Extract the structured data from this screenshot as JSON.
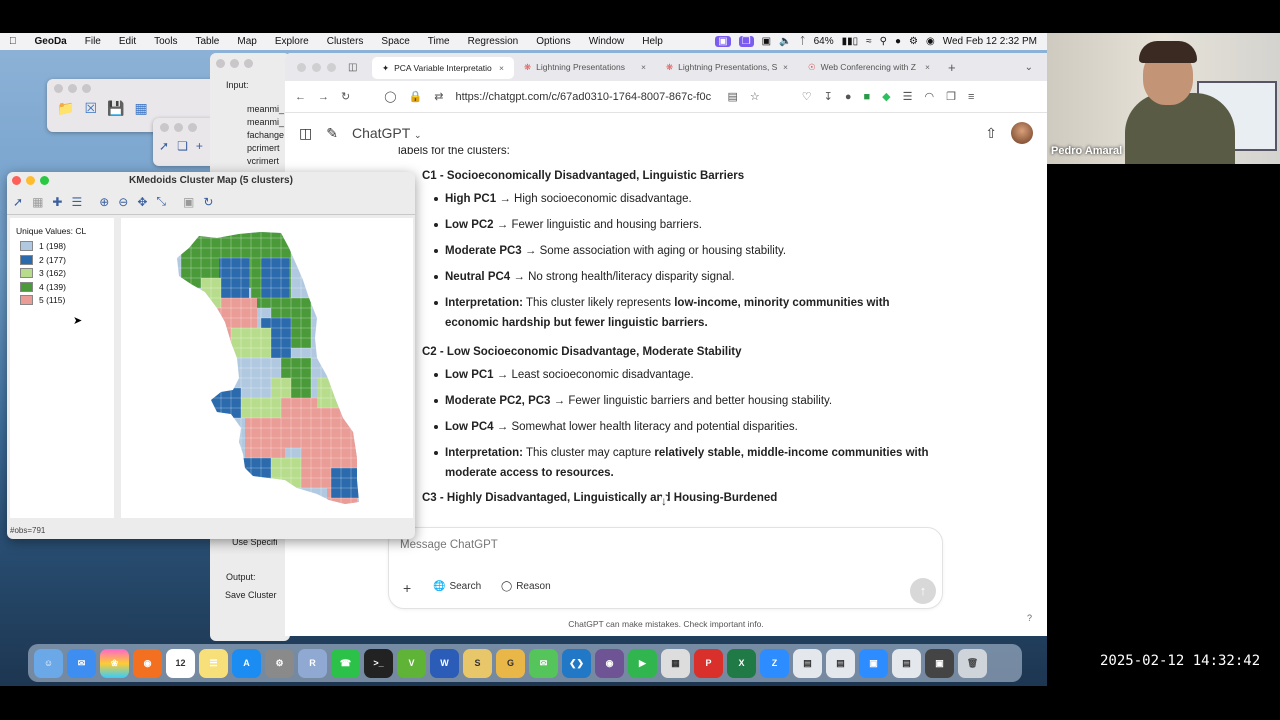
{
  "menubar": {
    "app": "GeoDa",
    "items": [
      "File",
      "Edit",
      "Tools",
      "Table",
      "Map",
      "Explore",
      "Clusters",
      "Space",
      "Time",
      "Regression",
      "Options",
      "Window",
      "Help"
    ],
    "battery": "64%",
    "datetime": "Wed Feb 12  2:32 PM"
  },
  "dialog": {
    "input_label": "Input:",
    "vars": [
      "meanmi_",
      "meanmi_",
      "fachange",
      "pcrimert",
      "vcrimert"
    ],
    "use_specific": "Use Specifi",
    "output_label": "Output:",
    "save_cluster": "Save Cluster"
  },
  "cluster_map": {
    "title": "KMedoids Cluster Map (5 clusters)",
    "legend_title": "Unique Values: CL",
    "legend": [
      {
        "label": "1 (198)",
        "color": "#b1c9e0"
      },
      {
        "label": "2 (177)",
        "color": "#2b6aad"
      },
      {
        "label": "3 (162)",
        "color": "#b7dd8c"
      },
      {
        "label": "4 (139)",
        "color": "#4a9a3a"
      },
      {
        "label": "5 (115)",
        "color": "#ea9c97"
      }
    ],
    "status": "#obs=791"
  },
  "browser": {
    "tabs": [
      "PCA Variable Interpretatio",
      "Lightning Presentations",
      "Lightning Presentations, S",
      "Web Conferencing with Z"
    ],
    "url": "https://chatgpt.com/c/67ad0310-1764-8007-867c-f0c"
  },
  "chatgpt": {
    "brand": "ChatGPT",
    "intro": "labels for the clusters:",
    "c1_title": "C1 - Socioeconomically Disadvantaged, Linguistic Barriers",
    "c1": [
      {
        "b": "High PC1",
        "t": " → High socioeconomic disadvantage."
      },
      {
        "b": "Low PC2",
        "t": " → Fewer linguistic and housing barriers."
      },
      {
        "b": "Moderate PC3",
        "t": " → Some association with aging or housing stability."
      },
      {
        "b": "Neutral PC4",
        "t": " → No strong health/literacy disparity signal."
      }
    ],
    "c1_interp_label": "Interpretation:",
    "c1_interp_text": " This cluster likely represents ",
    "c1_interp_bold": "low-income, minority communities with economic hardship but fewer linguistic barriers.",
    "c2_title": "C2 - Low Socioeconomic Disadvantage, Moderate Stability",
    "c2": [
      {
        "b": "Low PC1",
        "t": " → Least socioeconomic disadvantage."
      },
      {
        "b": "Moderate PC2, PC3",
        "t": " → Fewer linguistic barriers and better housing stability."
      },
      {
        "b": "Low PC4",
        "t": " → Somewhat lower health literacy and potential disparities."
      }
    ],
    "c2_interp_label": "Interpretation:",
    "c2_interp_text": " This cluster may capture ",
    "c2_interp_bold": "relatively stable, middle-income communities with moderate access to resources.",
    "c3_title": "C3 - Highly Disadvantaged, Linguistically and Housing-Burdened",
    "placeholder": "Message ChatGPT",
    "search": "Search",
    "reason": "Reason",
    "footer": "ChatGPT can make mistakes. Check important info.",
    "help": "?"
  },
  "video": {
    "name": "Pedro Amaral"
  },
  "timestamp": "2025-02-12  14:32:42"
}
